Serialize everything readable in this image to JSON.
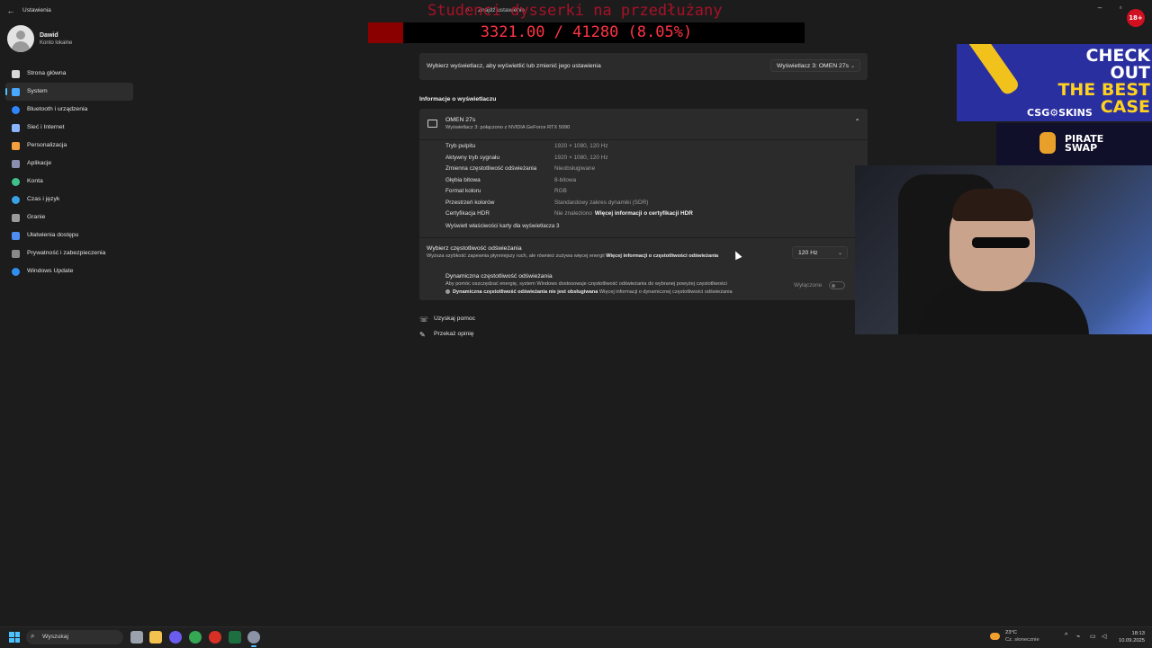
{
  "window": {
    "title": "Ustawienia",
    "search_placeholder": "Znajdź ustawienie",
    "controls": [
      "–",
      "▫",
      "✕"
    ]
  },
  "user": {
    "name": "Dawid",
    "account_type": "Konto lokalne"
  },
  "sidebar": {
    "items": [
      {
        "label": "Strona główna",
        "icon": "home-icon",
        "color": "#d9d9d9"
      },
      {
        "label": "System",
        "icon": "system-icon",
        "color": "#4aa8ff"
      },
      {
        "label": "Bluetooth i urządzenia",
        "icon": "bluetooth-icon",
        "color": "#2e86ff"
      },
      {
        "label": "Sieć i Internet",
        "icon": "wifi-icon",
        "color": "#8ab4ff"
      },
      {
        "label": "Personalizacja",
        "icon": "brush-icon",
        "color": "#f2a03d"
      },
      {
        "label": "Aplikacje",
        "icon": "apps-icon",
        "color": "#8a8fb0"
      },
      {
        "label": "Konta",
        "icon": "account-icon",
        "color": "#3fc28a"
      },
      {
        "label": "Czas i język",
        "icon": "globe-clock-icon",
        "color": "#3aa0e8"
      },
      {
        "label": "Granie",
        "icon": "gamepad-icon",
        "color": "#9a9a9a"
      },
      {
        "label": "Ułatwienia dostępu",
        "icon": "accessibility-icon",
        "color": "#4f8df0"
      },
      {
        "label": "Prywatność i zabezpieczenia",
        "icon": "shield-icon",
        "color": "#8a8a8a"
      },
      {
        "label": "Windows Update",
        "icon": "update-icon",
        "color": "#2f8ef0"
      }
    ],
    "active_index": 1
  },
  "main": {
    "display_select": {
      "label": "Wybierz wyświetlacz, aby wyświetlić lub zmienić jego ustawienia",
      "value": "Wyświetlacz 3: OMEN 27s"
    },
    "section_title": "Informacje o wyświetlaczu",
    "display": {
      "name": "OMEN 27s",
      "subtitle": "Wyświetlacz 3: połączono z NVIDIA GeForce RTX 5090",
      "properties": [
        {
          "key": "Tryb pulpitu",
          "value": "1920 × 1080, 120 Hz",
          "link": ""
        },
        {
          "key": "Aktywny tryb sygnału",
          "value": "1920 × 1080, 120 Hz",
          "link": ""
        },
        {
          "key": "Zmienna częstotliwość odświeżania",
          "value": "Nieobsługiwane",
          "link": ""
        },
        {
          "key": "Głębia bitowa",
          "value": "8-bitowa",
          "link": ""
        },
        {
          "key": "Format koloru",
          "value": "RGB",
          "link": ""
        },
        {
          "key": "Przestrzeń kolorów",
          "value": "Standardowy zakres dynamiki (SDR)",
          "link": ""
        },
        {
          "key": "Certyfikacja HDR",
          "value": "Nie znaleziono",
          "link": "Więcej informacji o certyfikacji HDR"
        }
      ],
      "adapter_link": "Wyświetl właściwości karty dla wyświetlacza 3"
    },
    "refresh": {
      "title": "Wybierz częstotliwość odświeżania",
      "subtitle": "Wyższa szybkość zapewnia płynniejszy ruch, ale również zużywa więcej energii",
      "link": "Więcej informacji o częstotliwości odświeżania",
      "value": "120 Hz"
    },
    "dynamic": {
      "title": "Dynamiczna częstotliwość odświeżania",
      "subtitle": "Aby pomóc oszczędzać energię, system Windows dostosowuje częstotliwość odświeżania do wybranej powyżej częstotliwości",
      "warning": "Dynamiczna częstotliwość odświeżania nie jest obsługiwana",
      "link": "Więcej informacji o dynamicznej częstotliwości odświeżania",
      "toggle_label": "Wyłączone",
      "toggle_on": false
    },
    "help": [
      {
        "label": "Uzyskaj pomoc",
        "icon": "help-icon"
      },
      {
        "label": "Przekaż opinię",
        "icon": "feedback-icon"
      }
    ]
  },
  "overlay": {
    "title": "Studenci dysserki na przedłużany",
    "counter": "3321.00 / 41280 (8.05%)",
    "progress": 0.0805,
    "promo_line1": "CHECK OUT",
    "promo_line2": "THE BEST",
    "promo_line3": "CASE",
    "promo_brand": "CSG⚙SKINS",
    "pirate_line1": "PIRATE",
    "pirate_line2": "SWAP",
    "age_badge": "18+"
  },
  "taskbar": {
    "search_placeholder": "Wyszukaj",
    "weather_temp": "23°C",
    "weather_desc": "Cz. słonecznie",
    "time": "18:13",
    "date": "10.09.2025"
  }
}
